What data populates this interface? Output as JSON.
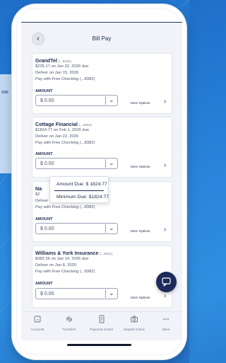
{
  "side_panel": {
    "text": "ow"
  },
  "header": {
    "title": "Bill Pay",
    "back_icon": "chevron-left-icon"
  },
  "bills": [
    {
      "payee": "GrandTel",
      "account": "(...5231)",
      "due": "$235.17 on Jan 22, 2026 due",
      "deliver": "Deliver on Jan 15, 2026",
      "pay_with": "Pay with Free Checking (...8382)",
      "amount_label": "AMOUNT",
      "amount_value": "$ 0.00",
      "more_options": "More Options"
    },
    {
      "payee": "Cottage Financial",
      "account": "(...2822)",
      "due": "$1824.77 on Feb 1, 2026 due",
      "deliver": "Deliver on Jan 22, 2026",
      "pay_with": "Pay with Free Checking (...8382)",
      "amount_label": "AMOUNT",
      "amount_value": "$ 0.00",
      "more_options": "More Options"
    },
    {
      "payee": "Na",
      "account": "",
      "due": "$2",
      "deliver": "Deliver on Jan 8, 2026",
      "pay_with": "Pay with Free Checking (...8382)",
      "amount_label": "AMOUNT",
      "amount_value": "$ 0.00",
      "more_options": "More Options"
    },
    {
      "payee": "Williams & York Insurance",
      "account": "(...5031)",
      "due": "$382.56 on Jan 14, 2026 due",
      "deliver": "Deliver on Jan 8, 2026",
      "pay_with": "Pay with Free Checking (...8382)",
      "amount_label": "AMOUNT",
      "amount_value": "$ 0.00",
      "more_options": "More Options"
    }
  ],
  "amount_dropdown": {
    "options": [
      "Amount Due: $ 1824.77",
      "Minimum Due: $1824.77"
    ]
  },
  "chat_button": {
    "icon": "chat-bubble-icon"
  },
  "tabs": [
    {
      "label": "Accounts",
      "icon": "accounts-icon"
    },
    {
      "label": "Transfers",
      "icon": "transfer-arrows-icon"
    },
    {
      "label": "Payment Center",
      "icon": "receipt-icon"
    },
    {
      "label": "Deposit Check",
      "icon": "camera-icon"
    },
    {
      "label": "More",
      "icon": "ellipsis-icon"
    }
  ],
  "colors": {
    "accent": "#1d2a5c",
    "background": "#2a86dc"
  }
}
